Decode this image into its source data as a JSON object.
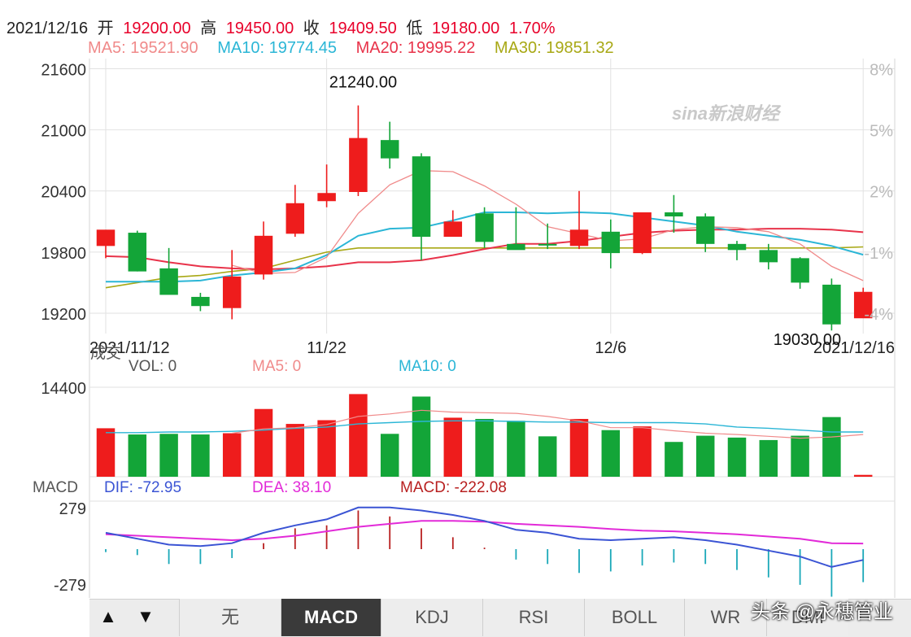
{
  "header": {
    "date": "2021/12/16",
    "open_label": "开",
    "open": "19200.00",
    "high_label": "高",
    "high": "19450.00",
    "close_label": "收",
    "close": "19409.50",
    "low_label": "低",
    "low": "19180.00",
    "change": "1.70%"
  },
  "ma_legend": [
    {
      "label": "MA5: 19521.90",
      "color": "#f08a8a"
    },
    {
      "label": "MA10: 19774.45",
      "color": "#2bb6d6"
    },
    {
      "label": "MA20: 19995.22",
      "color": "#e8334a"
    },
    {
      "label": "MA30: 19851.32",
      "color": "#a8a815"
    }
  ],
  "watermark": "sina新浪财经",
  "corner_watermark": "头条 @永穗管业",
  "colors": {
    "up": "#ee1c1c",
    "down": "#13a538",
    "grid": "#e2e2e2",
    "macd_dif": "#3b54d4",
    "macd_dea": "#e22ad8"
  },
  "chart_data": [
    {
      "type": "candlestick",
      "title": "",
      "ylim": [
        19000,
        21700
      ],
      "y_ticks_left": [
        "21600",
        "21000",
        "20400",
        "19800",
        "19200"
      ],
      "y_ticks_right": [
        "8%",
        "5%",
        "2%",
        "-1%",
        "-4%"
      ],
      "x_tick_labels": [
        "2021/11/12",
        "11/22",
        "12/6",
        "2021/12/16"
      ],
      "annotations": {
        "max": "21240.00",
        "min": "19030.00"
      },
      "candles": [
        {
          "o": 19860,
          "h": 20000,
          "l": 19740,
          "c": 20020
        },
        {
          "o": 19990,
          "h": 20010,
          "l": 19610,
          "c": 19610
        },
        {
          "o": 19640,
          "h": 19840,
          "l": 19390,
          "c": 19380
        },
        {
          "o": 19360,
          "h": 19400,
          "l": 19220,
          "c": 19270
        },
        {
          "o": 19250,
          "h": 19820,
          "l": 19140,
          "c": 19560
        },
        {
          "o": 19580,
          "h": 20100,
          "l": 19530,
          "c": 19960
        },
        {
          "o": 19980,
          "h": 20460,
          "l": 19950,
          "c": 20280
        },
        {
          "o": 20300,
          "h": 20660,
          "l": 20240,
          "c": 20380
        },
        {
          "o": 20390,
          "h": 21240,
          "l": 20350,
          "c": 20920
        },
        {
          "o": 20900,
          "h": 21080,
          "l": 20620,
          "c": 20720
        },
        {
          "o": 20740,
          "h": 20770,
          "l": 19720,
          "c": 19950
        },
        {
          "o": 19950,
          "h": 20210,
          "l": 19990,
          "c": 20100
        },
        {
          "o": 20180,
          "h": 20240,
          "l": 19840,
          "c": 19900
        },
        {
          "o": 19880,
          "h": 20240,
          "l": 19830,
          "c": 19820
        },
        {
          "o": 19880,
          "h": 20080,
          "l": 19830,
          "c": 19870
        },
        {
          "o": 19860,
          "h": 20400,
          "l": 19830,
          "c": 20020
        },
        {
          "o": 20000,
          "h": 20120,
          "l": 19640,
          "c": 19790
        },
        {
          "o": 19790,
          "h": 20130,
          "l": 19780,
          "c": 20190
        },
        {
          "o": 20190,
          "h": 20360,
          "l": 19990,
          "c": 20150
        },
        {
          "o": 20150,
          "h": 20180,
          "l": 19800,
          "c": 19880
        },
        {
          "o": 19880,
          "h": 19910,
          "l": 19720,
          "c": 19820
        },
        {
          "o": 19820,
          "h": 19880,
          "l": 19630,
          "c": 19700
        },
        {
          "o": 19740,
          "h": 19750,
          "l": 19440,
          "c": 19500
        },
        {
          "o": 19480,
          "h": 19540,
          "l": 19030,
          "c": 19090
        },
        {
          "o": 19150,
          "h": 19450,
          "l": 19180,
          "c": 19409.5
        }
      ],
      "ma5": [
        null,
        null,
        null,
        null,
        19670,
        19590,
        19600,
        19750,
        20180,
        20460,
        20600,
        20590,
        20450,
        20270,
        20050,
        19980,
        19910,
        19930,
        20020,
        20050,
        20040,
        20000,
        19880,
        19660,
        19520
      ],
      "ma10": [
        19510,
        19510,
        19510,
        19520,
        19570,
        19600,
        19640,
        19770,
        19960,
        20030,
        20040,
        20110,
        20190,
        20190,
        20180,
        20190,
        20180,
        20140,
        20100,
        20060,
        20000,
        19960,
        19920,
        19860,
        19774
      ],
      "ma20": [
        19760,
        19750,
        19700,
        19660,
        19640,
        19630,
        19640,
        19660,
        19700,
        19700,
        19720,
        19770,
        19830,
        19880,
        19880,
        19910,
        19950,
        19990,
        20010,
        20020,
        20020,
        20030,
        20030,
        20020,
        19995
      ],
      "ma30": [
        19450,
        19500,
        19550,
        19570,
        19610,
        19640,
        19720,
        19800,
        19840,
        19840,
        19840,
        19840,
        19840,
        19840,
        19840,
        19840,
        19840,
        19840,
        19840,
        19840,
        19840,
        19840,
        19840,
        19840,
        19851
      ]
    },
    {
      "type": "bar",
      "title": "成交",
      "legend": [
        {
          "label": "VOL: 0",
          "color": "#333333"
        },
        {
          "label": "MA5: 0",
          "color": "#f08a8a"
        },
        {
          "label": "MA10: 0",
          "color": "#2bb6d6"
        }
      ],
      "ylim": [
        0,
        14400
      ],
      "y_ticks": [
        "14400"
      ],
      "values": [
        7800,
        6800,
        6900,
        6800,
        7000,
        10900,
        8500,
        9100,
        13300,
        6900,
        12900,
        9500,
        9300,
        9000,
        6500,
        9300,
        7500,
        8100,
        5600,
        6600,
        6300,
        5900,
        6600,
        9600,
        300
      ],
      "ma5_line": [
        null,
        null,
        null,
        null,
        7000,
        7700,
        7900,
        8400,
        9700,
        10100,
        10700,
        10400,
        10300,
        10200,
        9700,
        9000,
        7900,
        7900,
        7400,
        7000,
        6800,
        6500,
        6200,
        6400,
        6800
      ],
      "ma10_line": [
        7100,
        7100,
        7200,
        7200,
        7300,
        7500,
        7800,
        8000,
        8500,
        8700,
        8900,
        9000,
        9000,
        8900,
        8800,
        8800,
        8700,
        8700,
        8700,
        8500,
        8000,
        7800,
        7500,
        7200,
        7200
      ]
    },
    {
      "type": "line",
      "title": "MACD",
      "legend": [
        {
          "label": "DIF: -72.95",
          "color": "#3b54d4"
        },
        {
          "label": "DEA: 38.10",
          "color": "#e22ad8"
        },
        {
          "label": "MACD: -222.08",
          "color": "#b82020"
        }
      ],
      "ylim": [
        -279,
        279
      ],
      "y_ticks": [
        "279",
        "-279"
      ],
      "dif": [
        110,
        70,
        30,
        20,
        40,
        110,
        160,
        200,
        280,
        280,
        260,
        230,
        190,
        130,
        110,
        70,
        60,
        70,
        80,
        60,
        30,
        -10,
        -50,
        -120,
        -73
      ],
      "dea": [
        100,
        90,
        80,
        70,
        60,
        70,
        90,
        120,
        150,
        170,
        190,
        190,
        185,
        170,
        160,
        150,
        135,
        125,
        120,
        110,
        100,
        85,
        70,
        40,
        38
      ],
      "macd": [
        -20,
        -40,
        -100,
        -100,
        -60,
        40,
        140,
        160,
        260,
        220,
        140,
        80,
        10,
        -70,
        -100,
        -160,
        -150,
        -110,
        -90,
        -100,
        -140,
        -190,
        -240,
        -320,
        -222
      ]
    }
  ],
  "tabs": [
    "无",
    "MACD",
    "KDJ",
    "RSI",
    "BOLL",
    "WR",
    "DMI"
  ],
  "active_tab": "MACD",
  "arrow_up": "▲",
  "arrow_down": "▼"
}
